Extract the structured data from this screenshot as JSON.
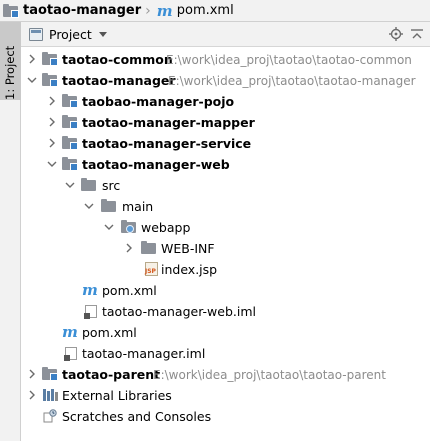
{
  "breadcrumb": {
    "project": "taotao-manager",
    "file": "pom.xml"
  },
  "stripe": {
    "tab_label": "1: Project"
  },
  "panel": {
    "title": "Project"
  },
  "tree": {
    "taotao_common": {
      "label": "taotao-common",
      "path": "E:\\work\\idea_proj\\taotao\\taotao-common"
    },
    "taotao_manager": {
      "label": "taotao-manager",
      "path": "E:\\work\\idea_proj\\taotao\\taotao-manager"
    },
    "pojo": {
      "label": "taobao-manager-pojo"
    },
    "mapper": {
      "label": "taotao-manager-mapper"
    },
    "service": {
      "label": "taotao-manager-service"
    },
    "web": {
      "label": "taotao-manager-web"
    },
    "src": {
      "label": "src"
    },
    "main": {
      "label": "main"
    },
    "webapp": {
      "label": "webapp"
    },
    "webinf": {
      "label": "WEB-INF"
    },
    "indexjsp": {
      "label": "index.jsp"
    },
    "web_pom": {
      "label": "pom.xml"
    },
    "web_iml": {
      "label": "taotao-manager-web.iml"
    },
    "manager_pom": {
      "label": "pom.xml"
    },
    "manager_iml": {
      "label": "taotao-manager.iml"
    },
    "taotao_parent": {
      "label": "taotao-parent",
      "path": "E:\\work\\idea_proj\\taotao\\taotao-parent"
    },
    "external_libraries": {
      "label": "External Libraries"
    },
    "scratches": {
      "label": "Scratches and Consoles"
    }
  },
  "colors": {
    "selection_text": "#000000",
    "path_gray": "#8c8c8c",
    "maven_blue": "#3b8fd6",
    "folder_gray": "#8c9199"
  }
}
